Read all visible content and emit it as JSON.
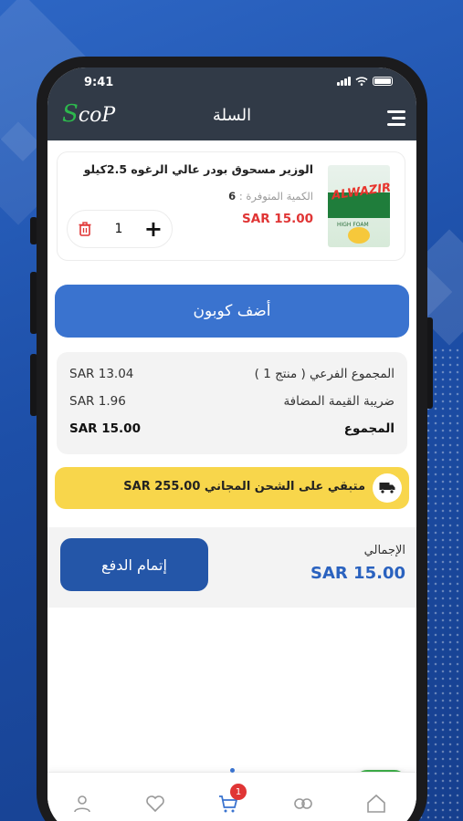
{
  "status_bar": {
    "time": "9:41"
  },
  "header": {
    "logo": "ScoP",
    "title": "السلة"
  },
  "product": {
    "name": "الوزير مسحوق بودر عالي الرغوه 2.5كيلو",
    "stock_label": "الكمية المتوفرة :",
    "stock_value": "6",
    "price": "SAR 15.00",
    "quantity": "1",
    "image_brand": "ALWAZIR LIX"
  },
  "coupon": {
    "label": "أضف كوبون"
  },
  "summary": {
    "rows": [
      {
        "label": "المجموع الفرعي ( منتج 1 )",
        "value": "SAR 13.04"
      },
      {
        "label": "ضريبة القيمة المضافة",
        "value": "SAR 1.96"
      },
      {
        "label": "المجموع",
        "value": "SAR 15.00"
      }
    ]
  },
  "shipping": {
    "text": "متبقي على الشحن المجاني SAR 255.00"
  },
  "checkout": {
    "button_label": "إتمام الدفع",
    "total_label": "الإجمالي",
    "total_value": "SAR 15.00"
  },
  "bottom_nav": {
    "cart_badge": "1"
  },
  "colors": {
    "header_bg": "#313a47",
    "primary": "#3a73cf",
    "checkout": "#2456a8",
    "price_red": "#e03535",
    "shipping_yellow": "#f8d64b",
    "whatsapp_green": "#3dae48"
  }
}
